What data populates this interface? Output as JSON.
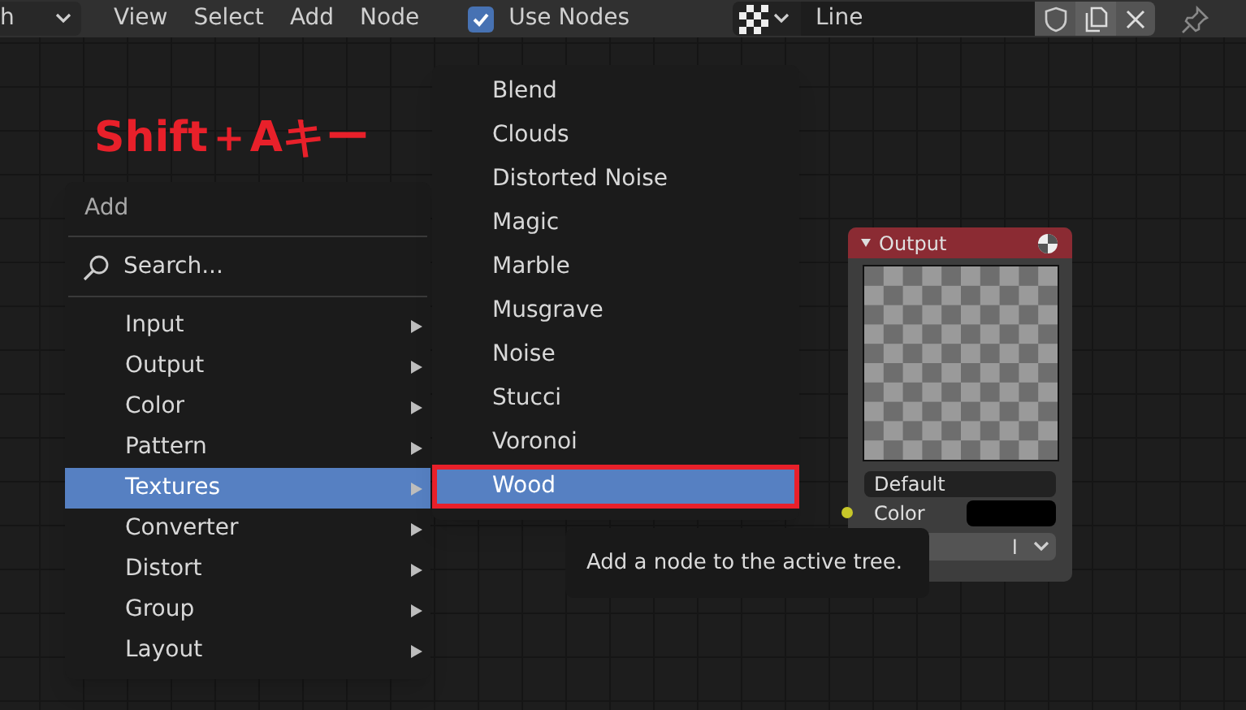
{
  "header": {
    "editor_type": "h",
    "menus": [
      "View",
      "Select",
      "Add",
      "Node"
    ],
    "use_nodes": {
      "label": "Use Nodes",
      "checked": true
    },
    "texture_name": "Line"
  },
  "annotation": {
    "caption": "Shift＋Aキー"
  },
  "add_menu": {
    "title": "Add",
    "search": "Search...",
    "items": [
      {
        "label": "Input",
        "selected": false
      },
      {
        "label": "Output",
        "selected": false
      },
      {
        "label": "Color",
        "selected": false
      },
      {
        "label": "Pattern",
        "selected": false
      },
      {
        "label": "Textures",
        "selected": true
      },
      {
        "label": "Converter",
        "selected": false
      },
      {
        "label": "Distort",
        "selected": false
      },
      {
        "label": "Group",
        "selected": false
      },
      {
        "label": "Layout",
        "selected": false
      }
    ]
  },
  "textures_menu": {
    "items": [
      {
        "label": "Blend",
        "selected": false
      },
      {
        "label": "Clouds",
        "selected": false
      },
      {
        "label": "Distorted Noise",
        "selected": false
      },
      {
        "label": "Magic",
        "selected": false
      },
      {
        "label": "Marble",
        "selected": false
      },
      {
        "label": "Musgrave",
        "selected": false
      },
      {
        "label": "Noise",
        "selected": false
      },
      {
        "label": "Stucci",
        "selected": false
      },
      {
        "label": "Voronoi",
        "selected": false
      },
      {
        "label": "Wood",
        "selected": true
      }
    ]
  },
  "output_node": {
    "title": "Output",
    "name_field": "Default",
    "color_label": "Color",
    "color": "#000000",
    "dropdown": "l"
  },
  "tooltip": "Add a node to the active tree."
}
